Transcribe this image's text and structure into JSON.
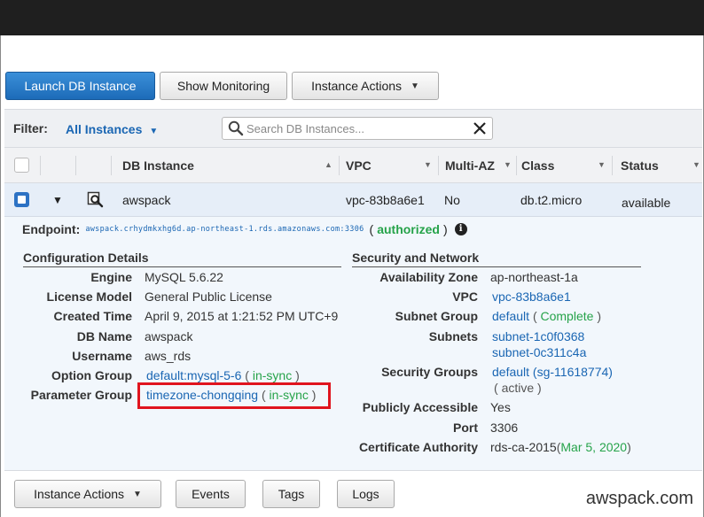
{
  "toolbar": {
    "launch": "Launch DB Instance",
    "monitoring": "Show Monitoring",
    "actions": "Instance Actions"
  },
  "filter": {
    "label": "Filter:",
    "selected": "All Instances",
    "search_placeholder": "Search DB Instances..."
  },
  "table": {
    "headers": {
      "db_instance": "DB Instance",
      "vpc": "VPC",
      "multi_az": "Multi-AZ",
      "class": "Class",
      "status": "Status"
    },
    "row": {
      "db_instance": "awspack",
      "vpc": "vpc-83b8a6e1",
      "multi_az": "No",
      "class": "db.t2.micro",
      "status": "available"
    }
  },
  "detail": {
    "endpoint_label": "Endpoint:",
    "endpoint_url": "awspack.crhydmkxhg6d.ap-northeast-1.rds.amazonaws.com:3306",
    "authorized": "authorized",
    "paren_open": "(",
    "paren_close": ")",
    "config": {
      "title": "Configuration Details",
      "engine_label": "Engine",
      "engine": "MySQL 5.6.22",
      "license_label": "License Model",
      "license": "General Public License",
      "created_label": "Created Time",
      "created": "April 9, 2015 at 1:21:52 PM UTC+9",
      "dbname_label": "DB Name",
      "dbname": "awspack",
      "username_label": "Username",
      "username": "aws_rds",
      "option_label": "Option Group",
      "option": "default:mysql-5-6",
      "option_status": "in-sync",
      "param_label": "Parameter Group",
      "param": "timezone-chongqing",
      "param_status": "in-sync"
    },
    "security": {
      "title": "Security and Network",
      "az_label": "Availability Zone",
      "az": "ap-northeast-1a",
      "vpc_label": "VPC",
      "vpc": "vpc-83b8a6e1",
      "subnet_group_label": "Subnet Group",
      "subnet_group": "default",
      "subnet_group_status": "Complete",
      "subnets_label": "Subnets",
      "subnet1": "subnet-1c0f0368",
      "subnet2": "subnet-0c311c4a",
      "sg_label": "Security Groups",
      "sg": "default (sg-11618774)",
      "sg_status": "active",
      "public_label": "Publicly Accessible",
      "public": "Yes",
      "port_label": "Port",
      "port": "3306",
      "ca_label": "Certificate Authority",
      "ca": "rds-ca-2015",
      "ca_date": "Mar 5, 2020"
    }
  },
  "bottom": {
    "actions": "Instance Actions",
    "events": "Events",
    "tags": "Tags",
    "logs": "Logs"
  },
  "watermark": "awspack.com",
  "colors": {
    "primary": "#1d6bb8",
    "link": "#1a66b3",
    "success": "#26a34a",
    "highlight": "#e0141e"
  }
}
